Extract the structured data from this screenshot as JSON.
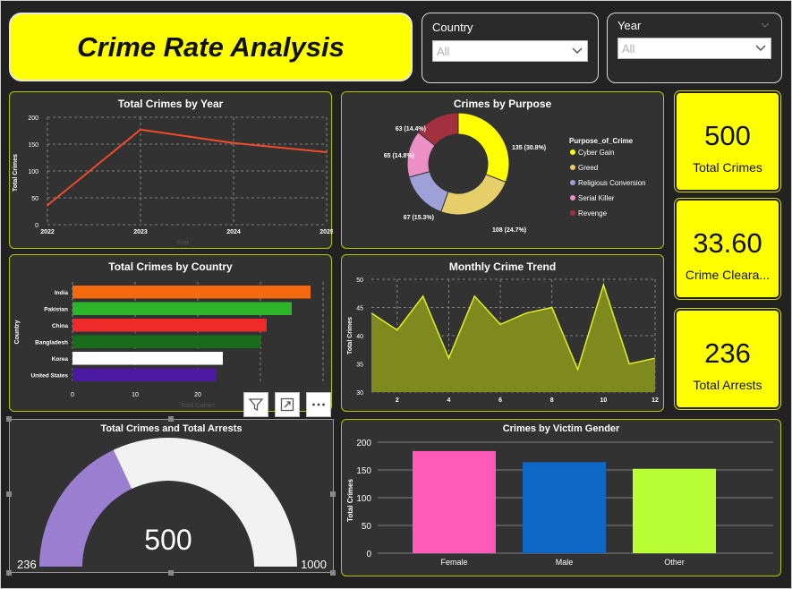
{
  "header": {
    "title": "Crime Rate Analysis"
  },
  "slicers": {
    "country": {
      "label": "Country",
      "value": "All"
    },
    "year": {
      "label": "Year",
      "value": "All"
    }
  },
  "kpis": [
    {
      "value": "500",
      "caption": "Total Crimes"
    },
    {
      "value": "33.60",
      "caption": "Crime Cleara..."
    },
    {
      "value": "236",
      "caption": "Total Arrests"
    }
  ],
  "charts": {
    "by_year": {
      "title": "Total Crimes by Year",
      "ylabel": "Total Crimes",
      "xlabel": "Year"
    },
    "by_purpose": {
      "title": "Crimes by Purpose",
      "legend_title": "Purpose_of_Crime"
    },
    "by_country": {
      "title": "Total Crimes by Country",
      "ylabel": "Country",
      "xlabel": "Total Crimes"
    },
    "monthly": {
      "title": "Monthly Crime Trend",
      "ylabel": "Total Crimes"
    },
    "gauge": {
      "title": "Total Crimes and Total Arrests",
      "value_label": "500",
      "min_label": "236",
      "max_label": "1000"
    },
    "gender": {
      "title": "Crimes by Victim Gender",
      "ylabel": "Total Crimes"
    }
  },
  "colors": {
    "accent_yellow": "#ffff00",
    "line_red": "#f04a2a",
    "area_olive": "#7f8a1e",
    "gauge_fill": "#9a7fd1",
    "gauge_track": "#f2f2f2"
  },
  "icons": {
    "filter": "filter-icon",
    "focus": "focus-mode-icon",
    "more": "more-options-icon"
  },
  "chart_data": [
    {
      "type": "line",
      "title": "Total Crimes by Year",
      "xlabel": "Year",
      "ylabel": "Total Crimes",
      "x": [
        2022,
        2023,
        2024,
        2025
      ],
      "y": [
        36,
        177,
        152,
        135
      ],
      "ylim": [
        0,
        200
      ],
      "yticks": [
        0,
        50,
        100,
        150,
        200
      ],
      "grid": true
    },
    {
      "type": "pie",
      "title": "Crimes by Purpose",
      "legend_title": "Purpose_of_Crime",
      "legend": "right",
      "slices": [
        {
          "name": "Cyber Gain",
          "value": 135,
          "label": "135 (30.8%)",
          "color": "#ffff00"
        },
        {
          "name": "Greed",
          "value": 108,
          "label": "108 (24.7%)",
          "color": "#e6cf6a"
        },
        {
          "name": "Religious Conversion",
          "value": 67,
          "label": "67 (15.3%)",
          "color": "#a0a0d8"
        },
        {
          "name": "Serial Killer",
          "value": 65,
          "label": "65 (14.8%)",
          "color": "#ec8fc6"
        },
        {
          "name": "Revenge",
          "value": 63,
          "label": "63 (14.4%)",
          "color": "#a2303e"
        }
      ]
    },
    {
      "type": "bar",
      "title": "Total Crimes by Country",
      "orientation": "horizontal",
      "xlabel": "Total Crimes",
      "ylabel": "Country",
      "categories": [
        "India",
        "Pakistan",
        "China",
        "Bangladesh",
        "Korea",
        "United States"
      ],
      "values": [
        38,
        35,
        31,
        30,
        24,
        23
      ],
      "colors": [
        "#f56a0f",
        "#2db52a",
        "#ee2a2a",
        "#186c1a",
        "#ffffff",
        "#4b1aa1"
      ],
      "xlim": [
        0,
        40
      ],
      "xticks": [
        0,
        10,
        20,
        30,
        40
      ],
      "grid": true
    },
    {
      "type": "area",
      "title": "Monthly Crime Trend",
      "ylabel": "Total Crimes",
      "x": [
        1,
        2,
        3,
        4,
        5,
        6,
        7,
        8,
        9,
        10,
        11,
        12
      ],
      "y": [
        44,
        41,
        47,
        36,
        47,
        42,
        44,
        45,
        34,
        49,
        35,
        36
      ],
      "ylim": [
        30,
        50
      ],
      "yticks": [
        30,
        35,
        40,
        45,
        50
      ],
      "xticks": [
        2,
        4,
        6,
        8,
        10,
        12
      ],
      "grid": true
    },
    {
      "type": "gauge",
      "title": "Total Crimes and Total Arrests",
      "value": 500,
      "target": 236,
      "min": 236,
      "max": 1000,
      "shown_fill": 0.36
    },
    {
      "type": "bar",
      "title": "Crimes by Victim Gender",
      "ylabel": "Total Crimes",
      "categories": [
        "Female",
        "Male",
        "Other"
      ],
      "values": [
        184,
        164,
        152
      ],
      "colors": [
        "#ff5ab8",
        "#1068c6",
        "#baff36"
      ],
      "ylim": [
        0,
        200
      ],
      "yticks": [
        0,
        50,
        100,
        150,
        200
      ],
      "grid": true
    }
  ]
}
